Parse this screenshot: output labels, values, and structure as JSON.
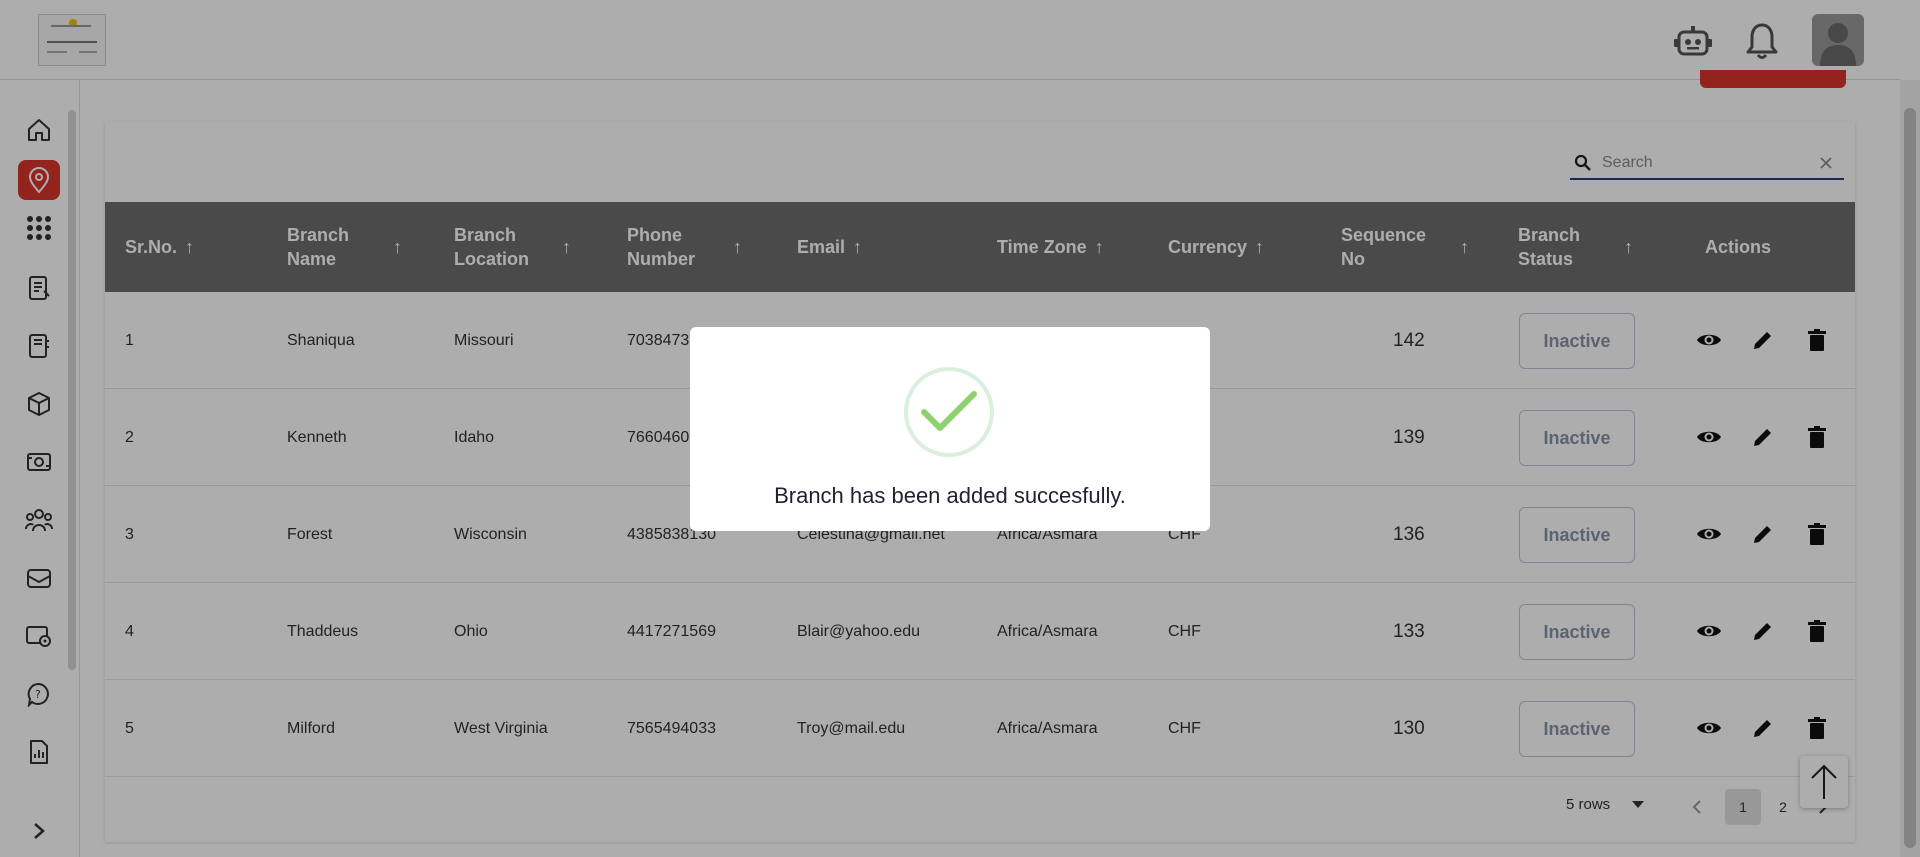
{
  "search": {
    "placeholder": "Search"
  },
  "table": {
    "columns": [
      {
        "label": "Sr.No."
      },
      {
        "label": "Branch Name"
      },
      {
        "label": "Branch Location"
      },
      {
        "label": "Phone Number"
      },
      {
        "label": "Email"
      },
      {
        "label": "Time Zone"
      },
      {
        "label": "Currency"
      },
      {
        "label": "Sequence No"
      },
      {
        "label": "Branch Status"
      },
      {
        "label": "Actions"
      }
    ],
    "rows": [
      {
        "sr": "1",
        "name": "Shaniqua",
        "location": "Missouri",
        "phone": "7038473",
        "email": "",
        "tz": "",
        "currency": "",
        "seq": "142",
        "status": "Inactive"
      },
      {
        "sr": "2",
        "name": "Kenneth",
        "location": "Idaho",
        "phone": "7660460",
        "email": "",
        "tz": "",
        "currency": "",
        "seq": "139",
        "status": "Inactive"
      },
      {
        "sr": "3",
        "name": "Forest",
        "location": "Wisconsin",
        "phone": "4385838130",
        "email": "Celestina@gmail.net",
        "tz": "Africa/Asmara",
        "currency": "CHF",
        "seq": "136",
        "status": "Inactive"
      },
      {
        "sr": "4",
        "name": "Thaddeus",
        "location": "Ohio",
        "phone": "4417271569",
        "email": "Blair@yahoo.edu",
        "tz": "Africa/Asmara",
        "currency": "CHF",
        "seq": "133",
        "status": "Inactive"
      },
      {
        "sr": "5",
        "name": "Milford",
        "location": "West Virginia",
        "phone": "7565494033",
        "email": "Troy@mail.edu",
        "tz": "Africa/Asmara",
        "currency": "CHF",
        "seq": "130",
        "status": "Inactive"
      }
    ]
  },
  "pagination": {
    "rows_label": "5 rows",
    "pages": [
      "1",
      "2"
    ],
    "current": "1"
  },
  "modal": {
    "message": "Branch has been added succesfully."
  },
  "colors": {
    "accent": "#d9342b",
    "header": "#6e6e6e",
    "success": "#8fd06f",
    "search_underline": "#2b3a86"
  },
  "icons": {
    "topbar": [
      "robot-icon",
      "bell-icon",
      "user-avatar-icon"
    ],
    "sidebar": [
      "home-icon",
      "location-pin-icon",
      "apps-grid-icon",
      "document-icon",
      "book-icon",
      "box-icon",
      "cash-icon",
      "team-icon",
      "mail-icon",
      "settings-cog-icon",
      "help-chat-icon",
      "report-icon",
      "chevron-right-icon"
    ],
    "row_actions": [
      "eye-icon",
      "pencil-icon",
      "trash-icon"
    ]
  }
}
